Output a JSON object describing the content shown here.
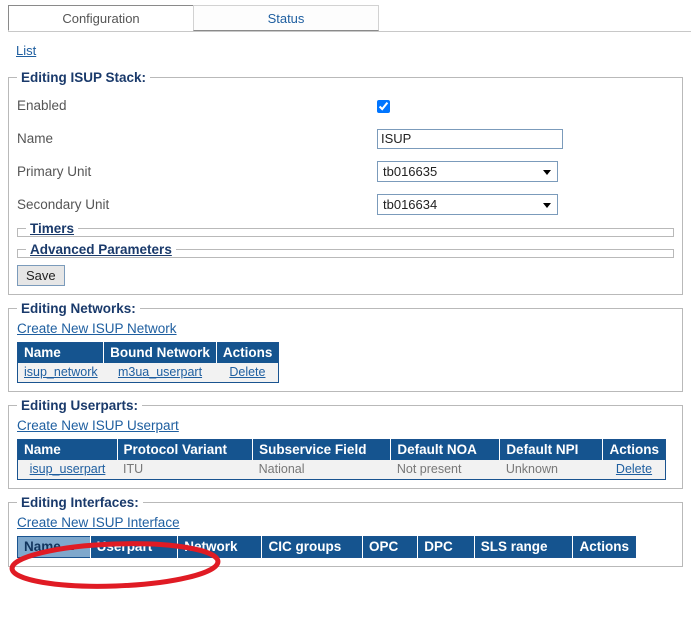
{
  "tabs": [
    {
      "label": "Configuration",
      "active": true
    },
    {
      "label": "Status",
      "active": false
    }
  ],
  "breadcrumb": {
    "list_label": "List"
  },
  "stack": {
    "legend": "Editing ISUP Stack:",
    "enabled_label": "Enabled",
    "enabled_checked": true,
    "name_label": "Name",
    "name_value": "ISUP",
    "primary_unit_label": "Primary Unit",
    "primary_unit_value": "tb016635",
    "secondary_unit_label": "Secondary Unit",
    "secondary_unit_value": "tb016634",
    "timers_legend": "Timers",
    "advanced_legend": "Advanced Parameters",
    "save_label": "Save"
  },
  "networks": {
    "legend": "Editing Networks:",
    "create_label": "Create New ISUP Network",
    "columns": [
      "Name",
      "Bound Network",
      "Actions"
    ],
    "rows": [
      {
        "name": "isup_network",
        "bound_network": "m3ua_userpart",
        "action": "Delete"
      }
    ]
  },
  "userparts": {
    "legend": "Editing Userparts:",
    "create_label": "Create New ISUP Userpart",
    "columns": [
      "Name",
      "Protocol Variant",
      "Subservice Field",
      "Default NOA",
      "Default NPI",
      "Actions"
    ],
    "rows": [
      {
        "name": "isup_userpart",
        "protocol_variant": "ITU",
        "subservice_field": "National",
        "default_noa": "Not present",
        "default_npi": "Unknown",
        "action": "Delete"
      }
    ]
  },
  "interfaces": {
    "legend": "Editing Interfaces:",
    "create_label": "Create New ISUP Interface",
    "columns": [
      "Name",
      "Userpart",
      "Network",
      "CIC groups",
      "OPC",
      "DPC",
      "SLS range",
      "Actions"
    ],
    "sorted_column": "Name",
    "sort_direction": "asc",
    "rows": []
  },
  "annotation": {
    "shape": "ellipse",
    "color": "#e01b24",
    "target": "Create New ISUP Interface"
  },
  "colors": {
    "table_header_blue": "#15548f",
    "sorted_header_blue": "#7fa8cc",
    "legend_navy": "#1a3a6b",
    "link_blue": "#1f5fa0",
    "annotation_red": "#e01b24"
  }
}
